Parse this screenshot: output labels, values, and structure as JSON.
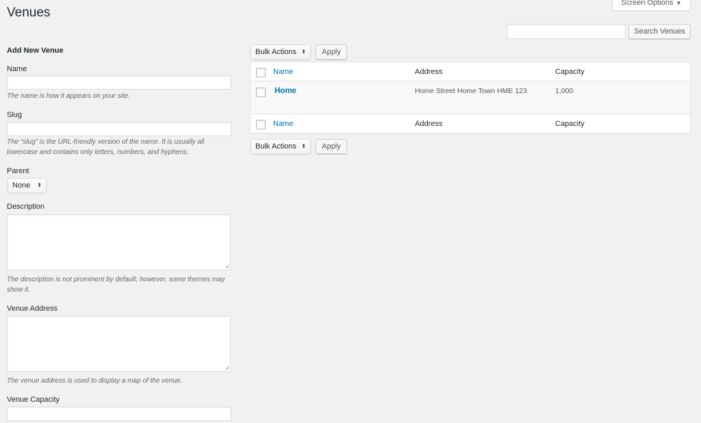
{
  "page": {
    "title": "Venues",
    "screen_options_label": "Screen Options",
    "screen_options_arrow": "▼"
  },
  "search": {
    "value": "",
    "placeholder": "",
    "button_label": "Search Venues"
  },
  "form": {
    "heading": "Add New Venue",
    "name": {
      "label": "Name",
      "value": "",
      "hint": "The name is how it appears on your site."
    },
    "slug": {
      "label": "Slug",
      "value": "",
      "hint": "The “slug” is the URL-friendly version of the name. It is usually all lowercase and contains only letters, numbers, and hyphens."
    },
    "parent": {
      "label": "Parent",
      "selected": "None"
    },
    "description": {
      "label": "Description",
      "value": "",
      "hint": "The description is not prominent by default; however, some themes may show it."
    },
    "venue_address": {
      "label": "Venue Address",
      "value": "",
      "hint": "The venue address is used to display a map of the venue."
    },
    "venue_capacity": {
      "label": "Venue Capacity",
      "value": ""
    }
  },
  "tablenav": {
    "bulk_actions_label": "Bulk Actions",
    "apply_label": "Apply",
    "updown_glyph": "⬍"
  },
  "table": {
    "columns": [
      "Name",
      "Address",
      "Capacity"
    ],
    "rows": [
      {
        "name": "Home",
        "address": "Home Street Home Town HME 123",
        "capacity": "1,000"
      }
    ]
  },
  "colors": {
    "link": "#0073aa",
    "background": "#f1f1f1"
  }
}
